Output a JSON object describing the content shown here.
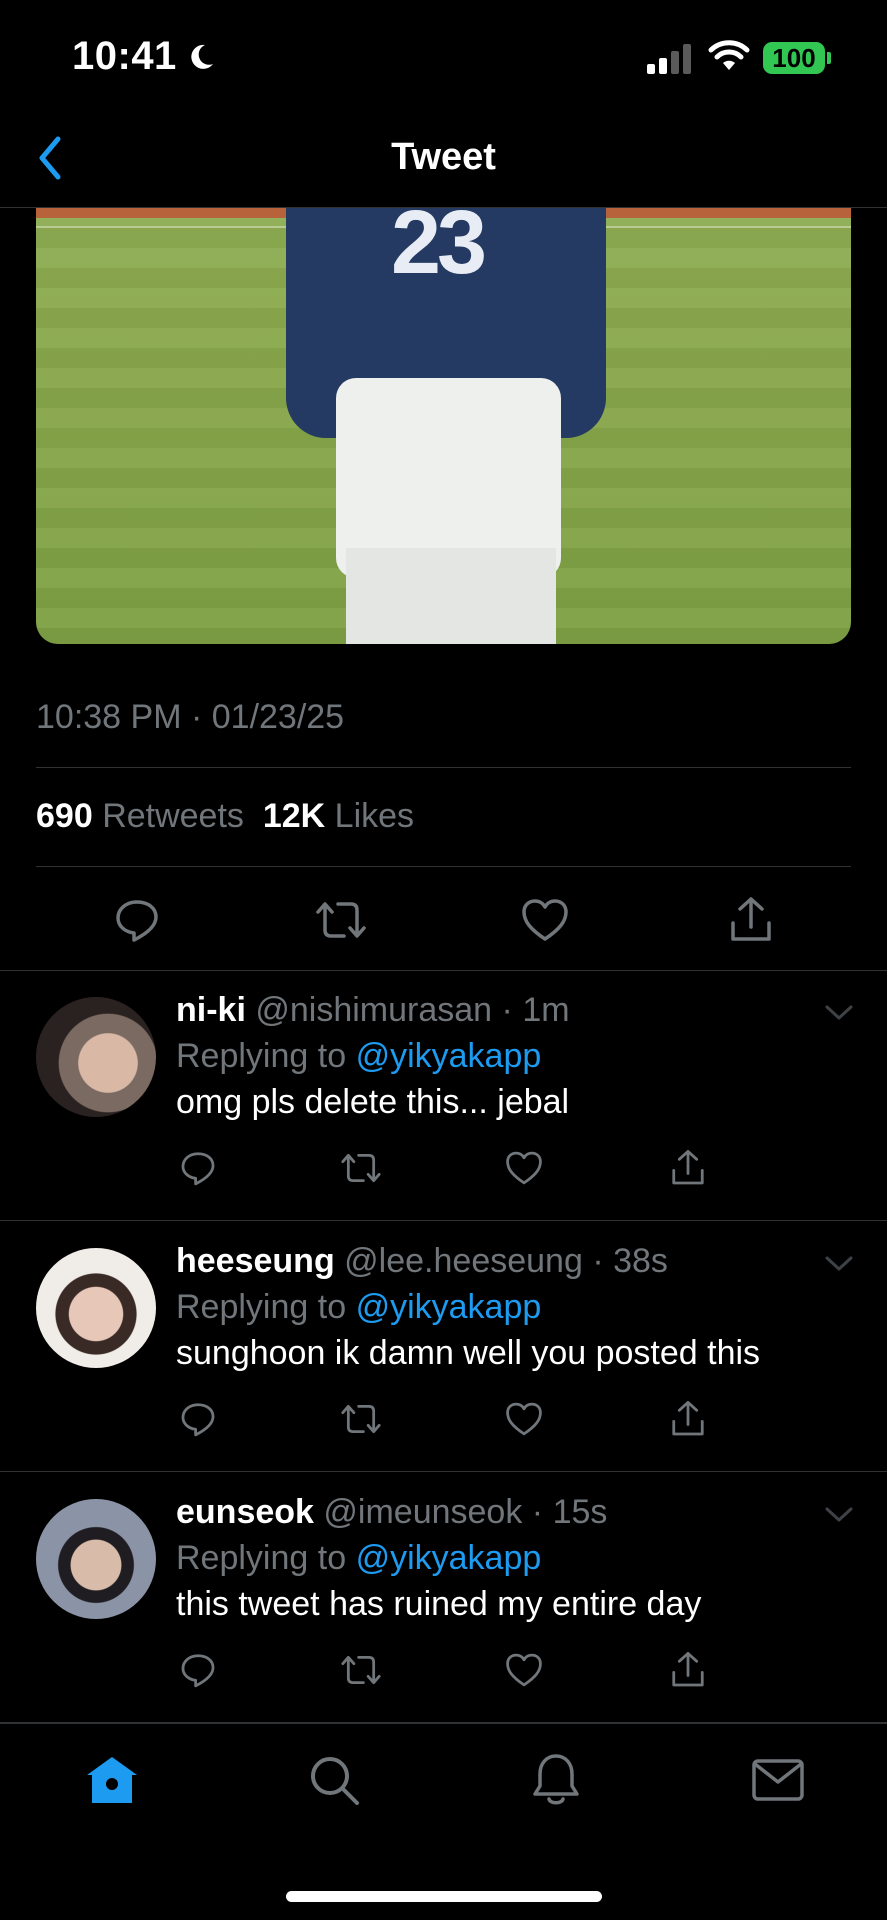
{
  "status_bar": {
    "time": "10:41",
    "battery": "100",
    "battery_color": "#32c653"
  },
  "header": {
    "title": "Tweet",
    "back_icon": "chevron-left-icon",
    "accent": "#1d9bf0"
  },
  "tweet": {
    "image_icon": "photo",
    "jersey_number": "23",
    "timestamp": "10:38 PM · 01/23/25",
    "retweets_count": "690",
    "retweets_label": "Retweets",
    "likes_count": "12K",
    "likes_label": "Likes",
    "actions": [
      "reply-icon",
      "retweet-icon",
      "like-icon",
      "share-icon"
    ]
  },
  "replies": [
    {
      "name": "ni-ki",
      "handle": "@nishimurasan",
      "time": "· 1m",
      "replying_prefix": "Replying to",
      "replying_to": "@yikyakapp",
      "text": "omg pls delete this... jebal"
    },
    {
      "name": "heeseung",
      "handle": "@lee.heeseung",
      "time": "· 38s",
      "replying_prefix": "Replying to",
      "replying_to": "@yikyakapp",
      "text": "sunghoon ik damn well you posted this"
    },
    {
      "name": "eunseok",
      "handle": "@imeunseok",
      "time": "· 15s",
      "replying_prefix": "Replying to",
      "replying_to": "@yikyakapp",
      "text": "this tweet has ruined my entire day"
    }
  ],
  "tab_bar": {
    "tabs": [
      "home-icon",
      "search-icon",
      "bell-icon",
      "mail-icon"
    ],
    "active_color": "#1d9bf0"
  }
}
